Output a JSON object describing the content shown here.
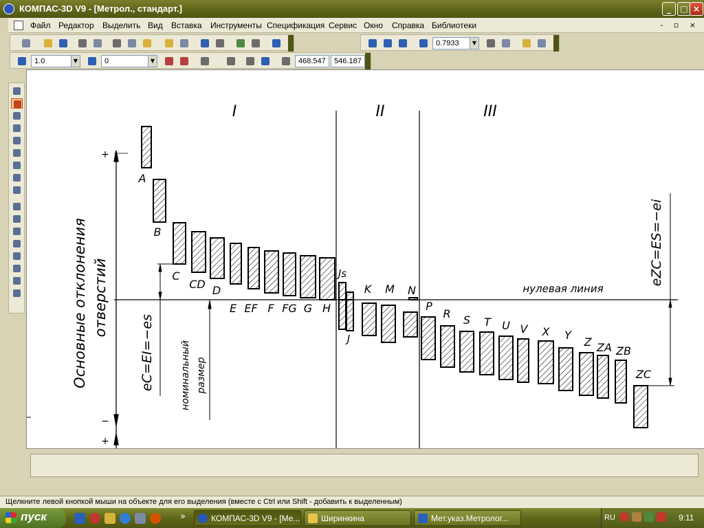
{
  "window": {
    "title": "КОМПАС-3D V9 - [Метрол., стандарт.]",
    "minimize": "_",
    "maximize": "□",
    "close": "×"
  },
  "menu": {
    "items": [
      "Файл",
      "Редактор",
      "Выделить",
      "Вид",
      "Вставка",
      "Инструменты",
      "Спецификация",
      "Сервис",
      "Окно",
      "Справка",
      "Библиотеки"
    ],
    "mdi_controls": "- ▫ ×"
  },
  "toolbar": {
    "zoom_value": "0.7933",
    "step_value": "1.0",
    "layer_value": "0",
    "coord_x": "468.547",
    "coord_y": "546.187"
  },
  "drawing": {
    "zones": [
      "I",
      "II",
      "III"
    ],
    "plus": "+",
    "minus": "−",
    "plus2": "+",
    "fundamental_label": "Основные отклонения",
    "holes_label": "отверстий",
    "nominal_label": "номинальный",
    "size_label": "размер",
    "zero_line": "нулевая линия",
    "ec_label": "eC=EI=−es",
    "ezc_label": "eZC=ES=−ei",
    "letters": {
      "A": "A",
      "B": "B",
      "C": "C",
      "CD": "CD",
      "D": "D",
      "E": "E",
      "EF": "EF",
      "F": "F",
      "FG": "FG",
      "G": "G",
      "H": "H",
      "Js": "Js",
      "J": "J",
      "K": "K",
      "M": "M",
      "N": "N",
      "P": "P",
      "R": "R",
      "S": "S",
      "T": "T",
      "U": "U",
      "V": "V",
      "X": "X",
      "Y": "Y",
      "Z": "Z",
      "ZA": "ZA",
      "ZB": "ZB",
      "ZC": "ZC"
    }
  },
  "statusbar": {
    "message": "Щелкните левой кнопкой мыши на объекте для его выделения (вместе с Ctrl или Shift - добавить к выделенным)"
  },
  "taskbar": {
    "start": "пуск",
    "chevron": "»",
    "tasks": [
      "КОМПАС-3D V9 - [Ме...",
      "Ширинкина",
      "Мет.указ.Метролог..."
    ],
    "lang": "RU",
    "clock": "9:11"
  }
}
